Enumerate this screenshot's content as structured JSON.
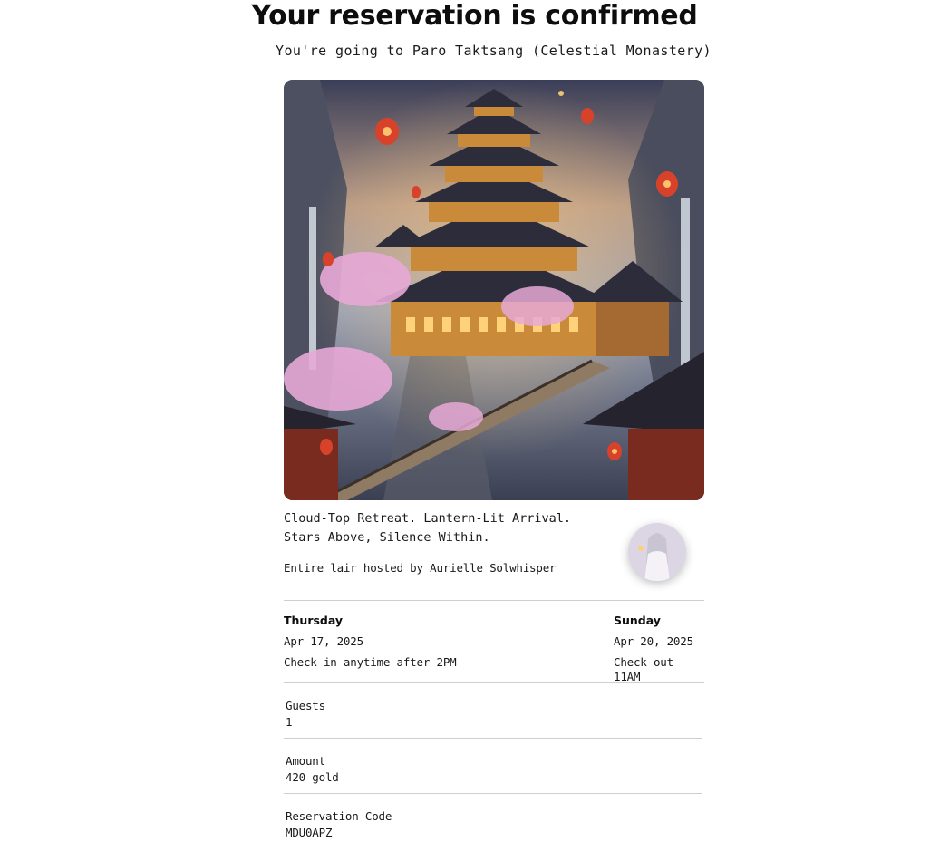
{
  "header": {
    "title": "Your reservation is confirmed",
    "subtitle": "You're going to Paro Taktsang (Celestial Monastery)"
  },
  "listing": {
    "title": "Cloud-Top Retreat. Lantern-Lit Arrival. Stars Above, Silence Within.",
    "host_line": "Entire lair hosted by Aurielle Solwhisper"
  },
  "checkin": {
    "day": "Thursday",
    "date": "Apr 17, 2025",
    "note": "Check in anytime after 2PM"
  },
  "checkout": {
    "day": "Sunday",
    "date": "Apr 20, 2025",
    "note": "Check out 11AM"
  },
  "details": {
    "guests_label": "Guests",
    "guests_value": "1",
    "amount_label": "Amount",
    "amount_value": "420 gold",
    "code_label": "Reservation Code",
    "code_value": "MDU0APZ"
  },
  "colors": {
    "text": "#111111",
    "divider": "#cfcfcf",
    "blossom": "#e7a9d6",
    "lantern": "#d9422a"
  }
}
